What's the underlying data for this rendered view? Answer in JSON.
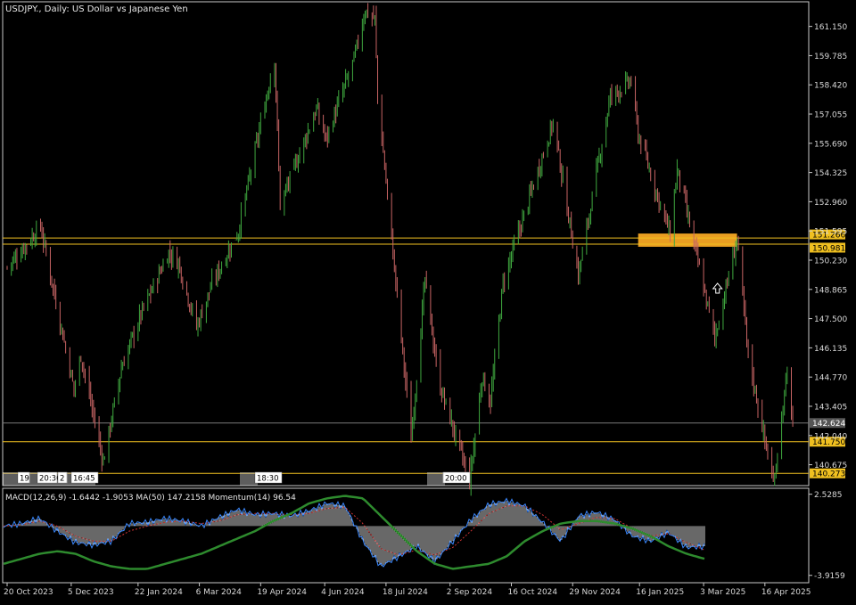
{
  "title": "USDJPY., Daily:  US Dollar vs Japanese Yen",
  "indicator_label": "MACD(12,26,9) -1.6442 -1.9053 MA(50) 147.2158 Momentum(14) 96.54",
  "colors": {
    "background": "#000000",
    "frame": "#c8c8c8",
    "bull": "#3fa83f",
    "bear": "#c86464",
    "hline": "#f0c020",
    "zone": "#f5a623",
    "price_line": "#7a7a7a",
    "histogram": "#d0d0d0",
    "macd_signal": "#cc3333",
    "macd_line": "#3a88ff",
    "ma_line": "#2e8b2e"
  },
  "chart_data": [
    {
      "type": "candlestick",
      "title": "USDJPY., Daily:  US Dollar vs Japanese Yen",
      "ylim": [
        139.7,
        162.3
      ],
      "yticks": [
        "161.150",
        "159.785",
        "158.420",
        "157.055",
        "155.690",
        "154.325",
        "152.960",
        "151.595",
        "150.230",
        "148.865",
        "147.500",
        "146.135",
        "144.770",
        "143.405",
        "142.040",
        "140.675"
      ],
      "xticks": [
        "20 Oct 2023",
        "5 Dec 2023",
        "22 Jan 2024",
        "6 Mar 2024",
        "19 Apr 2024",
        "4 Jun 2024",
        "18 Jul 2024",
        "2 Sep 2024",
        "16 Oct 2024",
        "29 Nov 2024",
        "16 Jan 2025",
        "3 Mar 2025",
        "16 Apr 2025"
      ],
      "price_path": [
        [
          "2023-10-20",
          149.9
        ],
        [
          "2023-11-13",
          151.8
        ],
        [
          "2023-12-07",
          144.2
        ],
        [
          "2023-12-12",
          145.8
        ],
        [
          "2023-12-28",
          140.8
        ],
        [
          "2024-01-10",
          145.2
        ],
        [
          "2024-01-24",
          147.7
        ],
        [
          "2024-02-13",
          150.6
        ],
        [
          "2024-02-20",
          150.1
        ],
        [
          "2024-03-04",
          147.1
        ],
        [
          "2024-03-15",
          149.1
        ],
        [
          "2024-04-03",
          151.6
        ],
        [
          "2024-04-29",
          159.7
        ],
        [
          "2024-05-03",
          152.8
        ],
        [
          "2024-05-29",
          157.3
        ],
        [
          "2024-06-05",
          155.9
        ],
        [
          "2024-06-25",
          159.6
        ],
        [
          "2024-07-03",
          161.9
        ],
        [
          "2024-07-10",
          161.5
        ],
        [
          "2024-07-12",
          157.9
        ],
        [
          "2024-08-05",
          141.9
        ],
        [
          "2024-08-15",
          149.3
        ],
        [
          "2024-08-25",
          144.5
        ],
        [
          "2024-09-16",
          139.9
        ],
        [
          "2024-09-25",
          144.8
        ],
        [
          "2024-10-01",
          143.6
        ],
        [
          "2024-10-10",
          149.2
        ],
        [
          "2024-11-15",
          156.7
        ],
        [
          "2024-12-03",
          149.5
        ],
        [
          "2024-12-26",
          157.9
        ],
        [
          "2025-01-10",
          158.6
        ],
        [
          "2025-01-15",
          156.1
        ],
        [
          "2025-02-07",
          151.4
        ],
        [
          "2025-02-12",
          154.5
        ],
        [
          "2025-03-11",
          146.6
        ],
        [
          "2025-03-27",
          151.2
        ],
        [
          "2025-04-04",
          145.8
        ],
        [
          "2025-04-22",
          139.8
        ],
        [
          "2025-05-02",
          144.9
        ],
        [
          "2025-05-06",
          142.6
        ]
      ],
      "horizontal_lines": [
        {
          "label": "151.266",
          "value": 151.266
        },
        {
          "label": "150.981",
          "value": 150.981
        },
        {
          "label": "141.750",
          "value": 141.75
        },
        {
          "label": "140.273",
          "value": 140.273
        }
      ],
      "current_price": {
        "label": "142.624",
        "value": 142.624
      },
      "highlight_zone": {
        "from": "2025-01-15",
        "to": "2025-03-27",
        "low": 150.981,
        "high": 151.266
      },
      "annotation": {
        "type": "up-arrow",
        "date": "2025-03-13",
        "value": 148.9
      },
      "time_markers": [
        "19",
        "20:30",
        "2",
        "16:45",
        "18:30",
        "20:00"
      ]
    },
    {
      "type": "line",
      "title": "MACD(12,26,9) -1.6442 -1.9053 MA(50) 147.2158 Momentum(14) 96.54",
      "ylim": [
        -4.5,
        3.0
      ],
      "yticks": [
        "2.5285",
        "-3.9159"
      ],
      "series": [
        {
          "name": "MACD",
          "values": [
            0.0,
            0.2,
            0.6,
            -0.4,
            -1.3,
            -1.5,
            -1.2,
            0.2,
            0.3,
            0.6,
            0.4,
            0.0,
            0.7,
            1.3,
            0.9,
            1.0,
            0.8,
            1.2,
            1.8,
            1.6,
            -1.2,
            -3.2,
            -2.4,
            -1.6,
            -2.8,
            -1.2,
            0.5,
            1.7,
            2.0,
            1.6,
            0.3,
            -1.2,
            0.8,
            1.1,
            0.5,
            -0.8,
            -1.2,
            -0.5,
            -1.7,
            -1.6
          ]
        },
        {
          "name": "Signal",
          "values": [
            0.0,
            0.1,
            0.4,
            0.0,
            -0.8,
            -1.2,
            -1.2,
            -0.4,
            0.0,
            0.3,
            0.4,
            0.2,
            0.4,
            0.9,
            1.0,
            1.0,
            0.9,
            1.0,
            1.4,
            1.5,
            0.2,
            -1.8,
            -2.3,
            -1.9,
            -2.3,
            -1.7,
            -0.4,
            1.0,
            1.6,
            1.6,
            0.9,
            -0.3,
            0.2,
            0.7,
            0.6,
            -0.2,
            -0.8,
            -0.6,
            -1.3,
            -1.9
          ]
        },
        {
          "name": "MA(50)",
          "values": [
            -3.0,
            -2.6,
            -2.2,
            -2.0,
            -2.2,
            -2.8,
            -3.2,
            -3.4,
            -3.4,
            -3.0,
            -2.6,
            -2.2,
            -1.6,
            -1.0,
            -0.4,
            0.4,
            1.0,
            1.8,
            2.2,
            2.4,
            2.2,
            0.8,
            -0.6,
            -2.0,
            -3.0,
            -3.4,
            -3.2,
            -3.0,
            -2.4,
            -1.2,
            -0.4,
            0.2,
            0.4,
            0.4,
            0.2,
            -0.2,
            -0.8,
            -1.6,
            -2.2,
            -2.6
          ]
        }
      ]
    }
  ]
}
